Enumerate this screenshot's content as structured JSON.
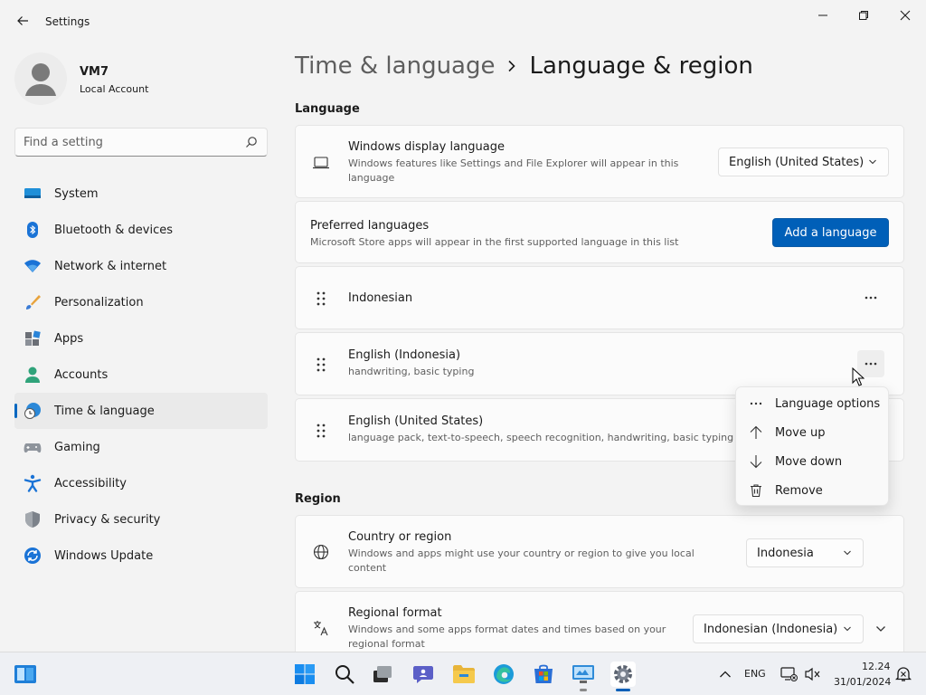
{
  "window": {
    "title": "Settings",
    "controls": {
      "minimize": "minimize-icon",
      "maximize": "maximize-icon",
      "close": "close-icon"
    }
  },
  "profile": {
    "name": "VM7",
    "account_type": "Local Account"
  },
  "search": {
    "placeholder": "Find a setting"
  },
  "sidebar": {
    "items": [
      {
        "label": "System",
        "icon": "system-icon"
      },
      {
        "label": "Bluetooth & devices",
        "icon": "bluetooth-icon"
      },
      {
        "label": "Network & internet",
        "icon": "wifi-icon"
      },
      {
        "label": "Personalization",
        "icon": "brush-icon"
      },
      {
        "label": "Apps",
        "icon": "apps-icon"
      },
      {
        "label": "Accounts",
        "icon": "accounts-icon"
      },
      {
        "label": "Time & language",
        "icon": "time-language-icon",
        "active": true
      },
      {
        "label": "Gaming",
        "icon": "gamepad-icon"
      },
      {
        "label": "Accessibility",
        "icon": "accessibility-icon"
      },
      {
        "label": "Privacy & security",
        "icon": "shield-icon"
      },
      {
        "label": "Windows Update",
        "icon": "update-icon"
      }
    ]
  },
  "breadcrumb": {
    "parent": "Time & language",
    "current": "Language & region"
  },
  "language_section": {
    "heading": "Language",
    "display_language": {
      "title": "Windows display language",
      "description": "Windows features like Settings and File Explorer will appear in this language",
      "value": "English (United States)"
    },
    "preferred": {
      "title": "Preferred languages",
      "description": "Microsoft Store apps will appear in the first supported language in this list",
      "button": "Add a language"
    },
    "languages": [
      {
        "name": "Indonesian",
        "features": ""
      },
      {
        "name": "English (Indonesia)",
        "features": "handwriting, basic typing"
      },
      {
        "name": "English (United States)",
        "features": "language pack, text-to-speech, speech recognition, handwriting, basic typing"
      }
    ]
  },
  "context_menu": {
    "items": [
      {
        "label": "Language options",
        "icon": "more-horizontal-icon"
      },
      {
        "label": "Move up",
        "icon": "arrow-up-icon"
      },
      {
        "label": "Move down",
        "icon": "arrow-down-icon"
      },
      {
        "label": "Remove",
        "icon": "trash-icon"
      }
    ]
  },
  "region_section": {
    "heading": "Region",
    "country": {
      "title": "Country or region",
      "description": "Windows and apps might use your country or region to give you local content",
      "value": "Indonesia"
    },
    "format": {
      "title": "Regional format",
      "description": "Windows and some apps format dates and times based on your regional format",
      "value": "Indonesian (Indonesia)"
    }
  },
  "taskbar": {
    "language": "ENG",
    "time": "12.24",
    "date": "31/01/2024"
  },
  "colors": {
    "accent": "#005fb8",
    "window_bg": "#f3f3f3",
    "card_bg": "#fbfbfb"
  }
}
